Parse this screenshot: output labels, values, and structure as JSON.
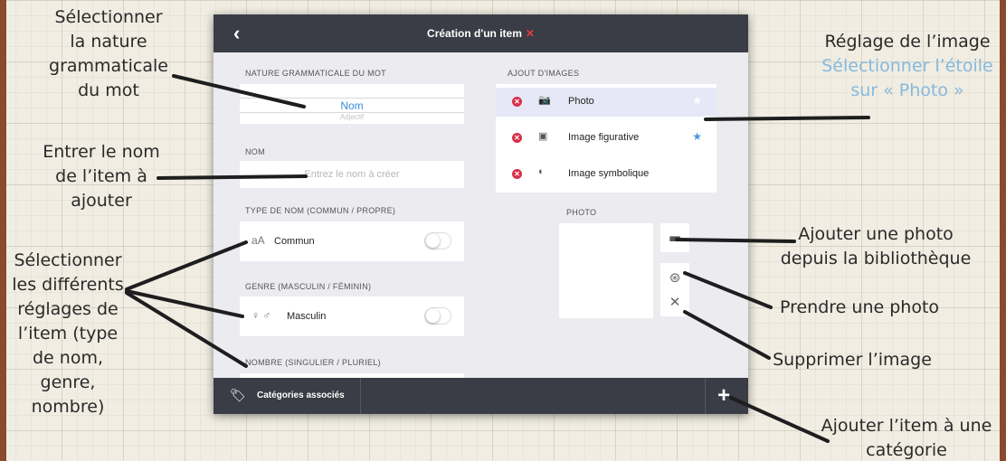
{
  "annotations": {
    "nature": "Sélectionner\nla nature\ngrammaticale\ndu mot",
    "nom": "Entrer le nom\nde l’item à\najouter",
    "reglages": "Sélectionner\nles différents\nréglages de\nl’item (type\nde nom,\ngenre,\nnombre)",
    "reglage_image_title": "Réglage de l’image",
    "reglage_image_hint": "Sélectionner l’étoile\nsur « Photo »",
    "ajouter_photo": "Ajouter une photo\ndepuis la bibliothèque",
    "prendre_photo": "Prendre une photo",
    "supprimer_image": "Supprimer l’image",
    "ajouter_item": "Ajouter l’item à une\ncatégorie"
  },
  "app": {
    "back_icon": "chevron-left-icon",
    "title": "Création d'un item",
    "title_mark": "✕",
    "nature": {
      "label": "NATURE GRAMMATICALE DU MOT",
      "selected": "Nom",
      "next_option": "Adjectif"
    },
    "nom": {
      "label": "NOM",
      "value": "",
      "placeholder": "Entrez le nom à créer"
    },
    "type_nom": {
      "label": "TYPE DE NOM (COMMUN / PROPRE)",
      "icon": "aA",
      "value": "Commun",
      "toggle_on": false
    },
    "genre": {
      "label": "GENRE (MASCULIN / FÉMININ)",
      "icon": "♀ ♂",
      "value": "Masculin",
      "toggle_on": false
    },
    "nombre": {
      "label": "NOMBRE (SINGULIER / PLURIEL)"
    },
    "images": {
      "label": "AJOUT D'IMAGES",
      "items": [
        {
          "label": "Photo",
          "icon": "camera-icon",
          "glyph": "📷",
          "starred": false,
          "active": true
        },
        {
          "label": "Image figurative",
          "icon": "image-icon",
          "glyph": "▣",
          "starred": true,
          "active": false
        },
        {
          "label": "Image symbolique",
          "icon": "contrast-icon",
          "glyph": "◐",
          "starred": false,
          "active": false
        }
      ]
    },
    "photo": {
      "label": "PHOTO",
      "buttons": [
        {
          "name": "library-button",
          "icon": "folder-icon",
          "glyph": "▬"
        },
        {
          "name": "camera-button",
          "icon": "camera-shutter-icon",
          "glyph": "⊛"
        },
        {
          "name": "delete-button",
          "icon": "close-icon",
          "glyph": "✕"
        }
      ]
    },
    "bottom": {
      "tag_icon": "tag-icon",
      "categories_label": "Catégories associés",
      "add_icon": "plus-icon",
      "add_glyph": "+"
    }
  },
  "colors": {
    "bar": "#3a3d45",
    "accent_blue": "#3b8ed8",
    "remove_red": "#d9304a",
    "star_blue": "#4a95e3",
    "hint_blue": "#86b9de"
  }
}
